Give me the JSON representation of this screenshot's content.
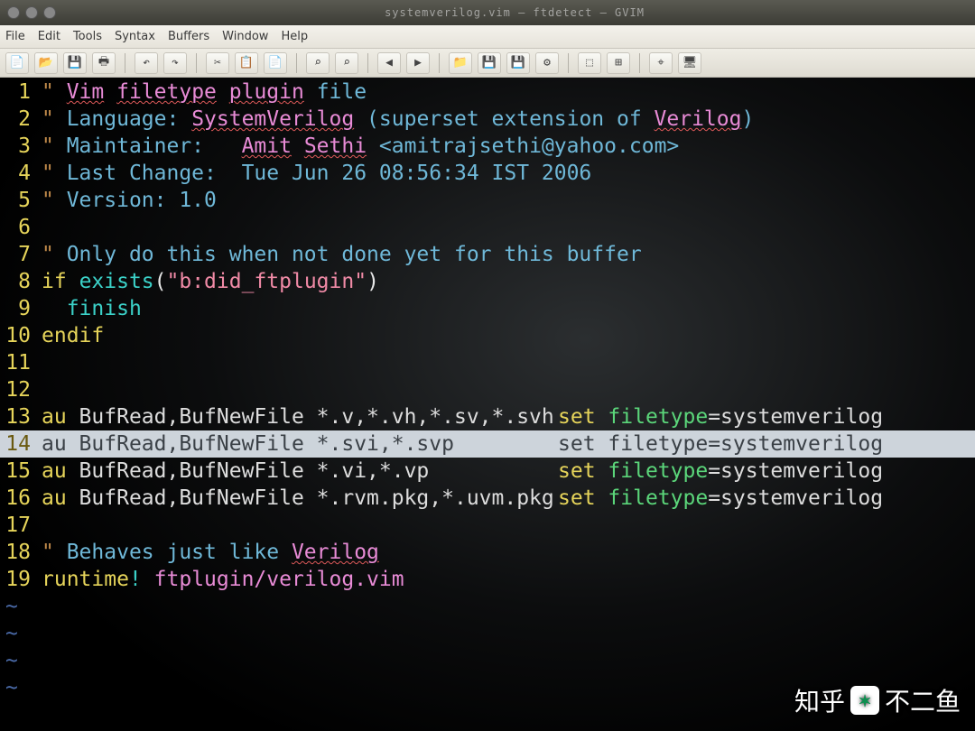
{
  "titlebar": {
    "title": "systemverilog.vim  —  ftdetect  —  GVIM"
  },
  "menu": [
    "File",
    "Edit",
    "Tools",
    "Syntax",
    "Buffers",
    "Window",
    "Help"
  ],
  "toolbar_icons": [
    "📄",
    "📂",
    "💾",
    "🖶",
    "|",
    "↶",
    "↷",
    "|",
    "✂",
    "📋",
    "📄",
    "|",
    "⌕",
    "⌕",
    "|",
    "◀",
    "▶",
    "|",
    "📁",
    "💾",
    "💾",
    "⚙",
    "|",
    "⬚",
    "⊞",
    "|",
    "⌖",
    "🖥"
  ],
  "lines": [
    {
      "n": 1,
      "seg": [
        [
          "c-quote",
          "\" "
        ],
        [
          "c-id wavy",
          "Vim"
        ],
        [
          "c-comment",
          " "
        ],
        [
          "c-id wavy",
          "filetype"
        ],
        [
          "c-comment",
          " "
        ],
        [
          "c-id wavy",
          "plugin"
        ],
        [
          "c-comment",
          " file"
        ]
      ]
    },
    {
      "n": 2,
      "seg": [
        [
          "c-quote",
          "\" "
        ],
        [
          "c-comment",
          "Language: "
        ],
        [
          "c-id wavy",
          "SystemVerilog"
        ],
        [
          "c-comment",
          " (superset extension of "
        ],
        [
          "c-id wavy",
          "Verilog"
        ],
        [
          "c-comment",
          ")"
        ]
      ]
    },
    {
      "n": 3,
      "seg": [
        [
          "c-quote",
          "\" "
        ],
        [
          "c-comment",
          "Maintainer:   "
        ],
        [
          "c-id wavy",
          "Amit"
        ],
        [
          "c-comment",
          " "
        ],
        [
          "c-id wavy",
          "Sethi"
        ],
        [
          "c-comment",
          " <amitrajsethi@yahoo.com>"
        ]
      ]
    },
    {
      "n": 4,
      "seg": [
        [
          "c-quote",
          "\" "
        ],
        [
          "c-comment",
          "Last Change:  Tue Jun 26 08:56:34 IST 2006"
        ]
      ]
    },
    {
      "n": 5,
      "seg": [
        [
          "c-quote",
          "\" "
        ],
        [
          "c-comment",
          "Version: 1.0"
        ]
      ]
    },
    {
      "n": 6,
      "seg": []
    },
    {
      "n": 7,
      "seg": [
        [
          "c-quote",
          "\" "
        ],
        [
          "c-comment",
          "Only do this when not done yet for this buffer"
        ]
      ]
    },
    {
      "n": 8,
      "seg": [
        [
          "c-key",
          "if"
        ],
        [
          "c-op",
          " "
        ],
        [
          "c-teal",
          "exists"
        ],
        [
          "c-op",
          "("
        ],
        [
          "c-str",
          "\"b:did_ftplugin\""
        ],
        [
          "c-op",
          ")"
        ]
      ]
    },
    {
      "n": 9,
      "seg": [
        [
          "c-op",
          "  "
        ],
        [
          "c-teal",
          "finish"
        ]
      ]
    },
    {
      "n": 10,
      "seg": [
        [
          "c-key",
          "endif"
        ]
      ]
    },
    {
      "n": 11,
      "seg": []
    },
    {
      "n": 12,
      "seg": []
    },
    {
      "n": 13,
      "seg": [
        [
          "c-key",
          "au"
        ],
        [
          "c-nf",
          " BufRead,BufNewFile *.v,*.vh,*.sv,*.svh"
        ]
      ],
      "right": [
        [
          "c-key",
          "set"
        ],
        [
          "c-nf",
          " "
        ],
        [
          "c-type",
          "filetype"
        ],
        [
          "c-nf",
          "=systemverilog"
        ]
      ]
    },
    {
      "n": 14,
      "hl": true,
      "seg": [
        [
          "c-key",
          "au"
        ],
        [
          "c-nf",
          " BufRead,BufNewFile *.svi,*.svp"
        ]
      ],
      "right": [
        [
          "c-key",
          "set"
        ],
        [
          "c-nf",
          " "
        ],
        [
          "c-type",
          "filetype"
        ],
        [
          "c-nf",
          "=systemverilog"
        ]
      ]
    },
    {
      "n": 15,
      "seg": [
        [
          "c-key",
          "au"
        ],
        [
          "c-nf",
          " BufRead,BufNewFile *.vi,*.vp"
        ]
      ],
      "right": [
        [
          "c-key",
          "set"
        ],
        [
          "c-nf",
          " "
        ],
        [
          "c-type",
          "filetype"
        ],
        [
          "c-nf",
          "=systemverilog"
        ]
      ]
    },
    {
      "n": 16,
      "seg": [
        [
          "c-key",
          "au"
        ],
        [
          "c-nf",
          " BufRead,BufNewFile *.rvm.pkg,*.uvm.pkg"
        ]
      ],
      "right": [
        [
          "c-key",
          "set"
        ],
        [
          "c-nf",
          " "
        ],
        [
          "c-type",
          "filetype"
        ],
        [
          "c-nf",
          "=systemverilog"
        ]
      ]
    },
    {
      "n": 17,
      "seg": []
    },
    {
      "n": 18,
      "seg": [
        [
          "c-quote",
          "\" "
        ],
        [
          "c-comment",
          "Behaves just like "
        ],
        [
          "c-id wavy",
          "Verilog"
        ]
      ]
    },
    {
      "n": 19,
      "seg": [
        [
          "c-key",
          "runtime"
        ],
        [
          "c-teal",
          "!"
        ],
        [
          "c-nf",
          " "
        ],
        [
          "c-id",
          "ftplugin/verilog.vim"
        ]
      ]
    }
  ],
  "tildes": 4,
  "watermark": {
    "prefix": "知乎",
    "suffix": "不二鱼"
  }
}
